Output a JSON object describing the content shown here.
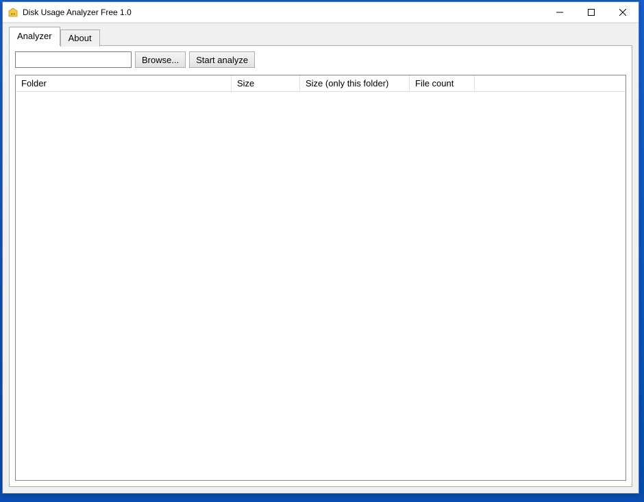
{
  "window": {
    "title": "Disk Usage Analyzer Free 1.0"
  },
  "tabs": {
    "analyzer": "Analyzer",
    "about": "About",
    "active": "analyzer"
  },
  "toolbar": {
    "path_value": "",
    "browse_label": "Browse...",
    "start_label": "Start analyze"
  },
  "listview": {
    "columns": {
      "folder": "Folder",
      "size": "Size",
      "size_only": "Size (only this folder)",
      "file_count": "File count"
    },
    "column_widths": {
      "folder": 315,
      "size": 100,
      "size_only": 160,
      "file_count": 95
    },
    "rows": []
  }
}
